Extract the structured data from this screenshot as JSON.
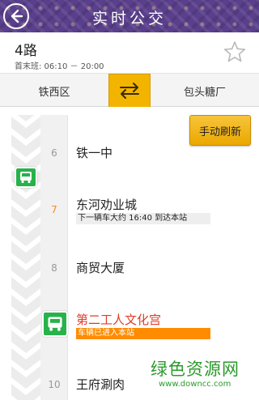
{
  "header": {
    "title": "实时公交"
  },
  "route": {
    "name": "4路",
    "hours": "首末班: 06:10 － 20:00"
  },
  "direction": {
    "from": "铁西区",
    "to": "包头糖厂"
  },
  "refresh_label": "手动刷新",
  "stations": [
    {
      "num": "6",
      "name": "铁一中",
      "info": "",
      "num_color": "#999999",
      "name_color": "#222222"
    },
    {
      "num": "7",
      "name": "东河劝业城",
      "info": "下一辆车大约 16:40 到达本站",
      "num_color": "#f08c1e",
      "name_color": "#222222"
    },
    {
      "num": "8",
      "name": "商贸大厦",
      "info": "",
      "num_color": "#999999",
      "name_color": "#222222"
    },
    {
      "num": "",
      "name": "第二工人文化宫",
      "info": "车辆已进入本站",
      "num_color": "#999999",
      "name_color": "#e03c28"
    },
    {
      "num": "10",
      "name": "王府涮肉",
      "info": "",
      "num_color": "#999999",
      "name_color": "#222222"
    }
  ],
  "watermark": {
    "text": "绿色资源网",
    "url": "www.downcc.com"
  },
  "colors": {
    "header_bg": "#5a3f8c",
    "accent": "#f3b400",
    "bus_green": "#27b24a",
    "arrived_bar": "#ff8c00",
    "next_bar": "#eeeeee",
    "highlight_text": "#e03c28"
  },
  "icons": {
    "back": "back-arrow-icon",
    "star": "star-outline-icon",
    "swap": "swap-direction-icon",
    "bus": "bus-icon"
  }
}
